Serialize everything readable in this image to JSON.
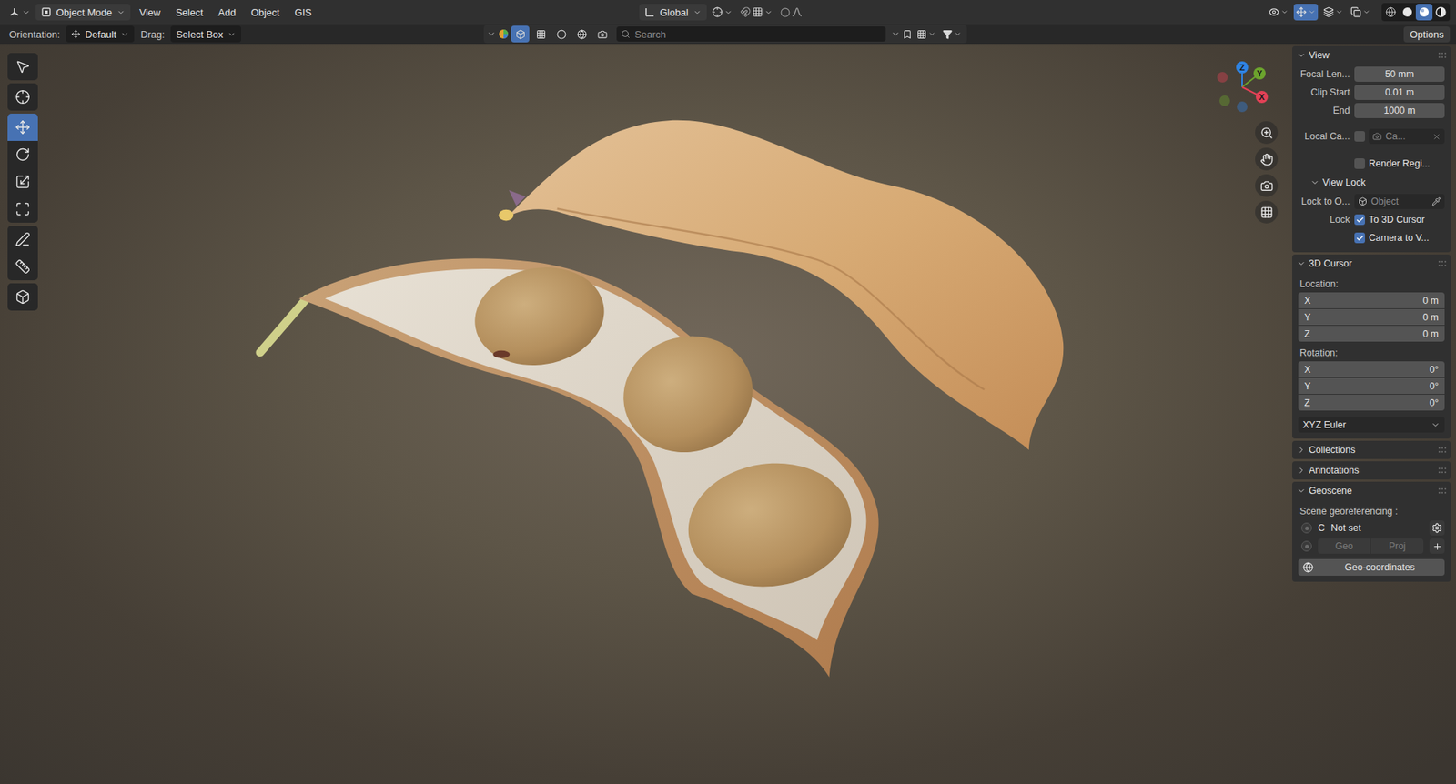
{
  "header": {
    "mode": "Object Mode",
    "menus": [
      "View",
      "Select",
      "Add",
      "Object",
      "GIS"
    ],
    "transform_orientation": "Global",
    "viewport_toggles": [
      {
        "kind": "visibility",
        "selected": false
      },
      {
        "kind": "gizmos",
        "selected": true
      },
      {
        "kind": "overlays",
        "selected": false
      },
      {
        "kind": "xray",
        "selected": false
      }
    ],
    "shading": [
      {
        "kind": "wireframe",
        "selected": false
      },
      {
        "kind": "solid",
        "selected": false
      },
      {
        "kind": "material",
        "selected": true
      },
      {
        "kind": "rendered",
        "selected": false
      }
    ]
  },
  "tool_header": {
    "orientation_label": "Orientation:",
    "orientation": "Default",
    "drag_label": "Drag:",
    "drag": "Select Box",
    "filters": [
      {
        "kind": "object",
        "selected": true
      },
      {
        "kind": "mesh",
        "selected": false
      },
      {
        "kind": "light",
        "selected": false
      },
      {
        "kind": "world",
        "selected": false
      },
      {
        "kind": "image",
        "selected": false
      }
    ],
    "search_placeholder": "Search",
    "options": "Options"
  },
  "toolbar": {
    "groups": [
      [
        {
          "kind": "select",
          "selected": false
        }
      ],
      [
        {
          "kind": "cursor",
          "selected": false
        }
      ],
      [
        {
          "kind": "move",
          "selected": true
        },
        {
          "kind": "rotate",
          "selected": false
        },
        {
          "kind": "scale",
          "selected": false
        },
        {
          "kind": "transform",
          "selected": false
        }
      ],
      [
        {
          "kind": "annotate",
          "selected": false
        },
        {
          "kind": "measure",
          "selected": false
        }
      ],
      [
        {
          "kind": "add-cube",
          "selected": false
        }
      ]
    ]
  },
  "gizmo": {
    "axes": [
      {
        "label": "Z",
        "color": "#2f83e3"
      },
      {
        "label": "Y",
        "color": "#6ca32d"
      },
      {
        "label": "X",
        "color": "#e34156"
      }
    ]
  },
  "sidebar": {
    "view": {
      "title": "View",
      "expanded": true,
      "fields": [
        {
          "label": "Focal Len...",
          "value": "50 mm"
        },
        {
          "label": "Clip Start",
          "value": "0.01 m"
        },
        {
          "label": "End",
          "value": "1000 m"
        }
      ],
      "local_camera": {
        "label": "Local Ca...",
        "checked": false,
        "value": "Ca...",
        "disabled": true
      },
      "render_region": {
        "label": "Render Regi...",
        "checked": false
      },
      "view_lock": {
        "title": "View Lock",
        "expanded": true,
        "lock_object_label": "Lock to O...",
        "lock_object_placeholder": "Object",
        "lock_label": "Lock",
        "locks": [
          {
            "label": "To 3D Cursor",
            "checked": true
          },
          {
            "label": "Camera to V...",
            "checked": true
          }
        ]
      }
    },
    "cursor": {
      "title": "3D Cursor",
      "expanded": true,
      "location_label": "Location:",
      "location": [
        {
          "axis": "X",
          "value": "0 m"
        },
        {
          "axis": "Y",
          "value": "0 m"
        },
        {
          "axis": "Z",
          "value": "0 m"
        }
      ],
      "rotation_label": "Rotation:",
      "rotation": [
        {
          "axis": "X",
          "value": "0°"
        },
        {
          "axis": "Y",
          "value": "0°"
        },
        {
          "axis": "Z",
          "value": "0°"
        }
      ],
      "rotation_mode": "XYZ Euler"
    },
    "collapsed_panels": [
      {
        "title": "Collections",
        "expanded": false
      },
      {
        "title": "Annotations",
        "expanded": false
      }
    ],
    "geoscene": {
      "title": "Geoscene",
      "expanded": true,
      "label": "Scene georeferencing :",
      "crs": {
        "selected": false,
        "letter": "C",
        "value": "Not set"
      },
      "geo": {
        "selected": false,
        "tabs": [
          "Geo",
          "Proj"
        ],
        "disabled": true
      },
      "button": "Geo-coordinates"
    }
  }
}
